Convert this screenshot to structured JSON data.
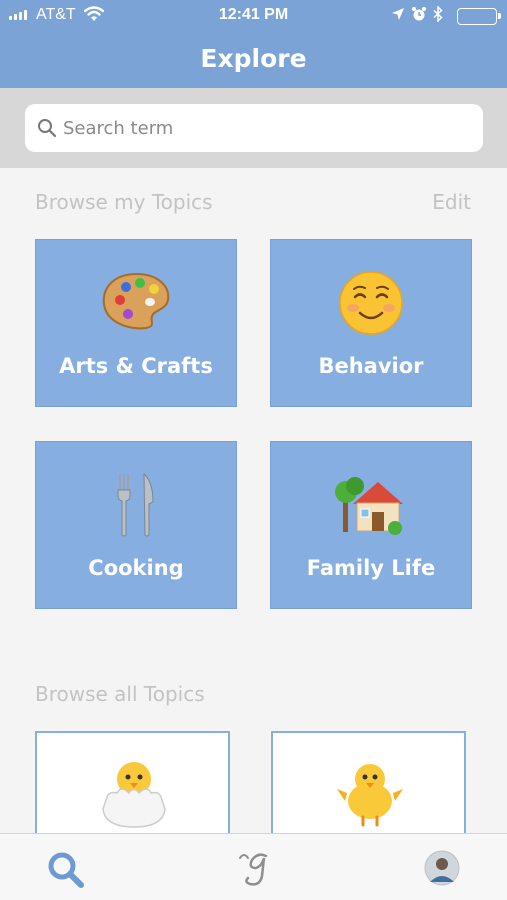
{
  "status_bar": {
    "carrier": "AT&T",
    "time": "12:41 PM",
    "battery_color": "#5fd35f"
  },
  "header": {
    "title": "Explore"
  },
  "search": {
    "placeholder": "Search term"
  },
  "my_topics": {
    "title": "Browse my Topics",
    "edit_label": "Edit",
    "tiles": [
      {
        "label": "Arts & Crafts",
        "icon": "palette-icon"
      },
      {
        "label": "Behavior",
        "icon": "smiling-face-icon"
      },
      {
        "label": "Cooking",
        "icon": "fork-knife-icon"
      },
      {
        "label": "Family Life",
        "icon": "house-garden-icon"
      }
    ]
  },
  "all_topics": {
    "title": "Browse all Topics",
    "tiles": [
      {
        "icon": "hatching-chick-icon"
      },
      {
        "icon": "baby-chick-icon"
      }
    ]
  },
  "tab_bar": {
    "tabs": [
      {
        "name": "explore",
        "icon": "search-icon",
        "active": true
      },
      {
        "name": "feed",
        "icon": "script-g-icon",
        "active": false
      },
      {
        "name": "profile",
        "icon": "avatar-icon",
        "active": false
      }
    ]
  },
  "colors": {
    "brand": "#7ba3d6",
    "tile": "#86aee0",
    "tab_active": "#6d9ad3"
  }
}
